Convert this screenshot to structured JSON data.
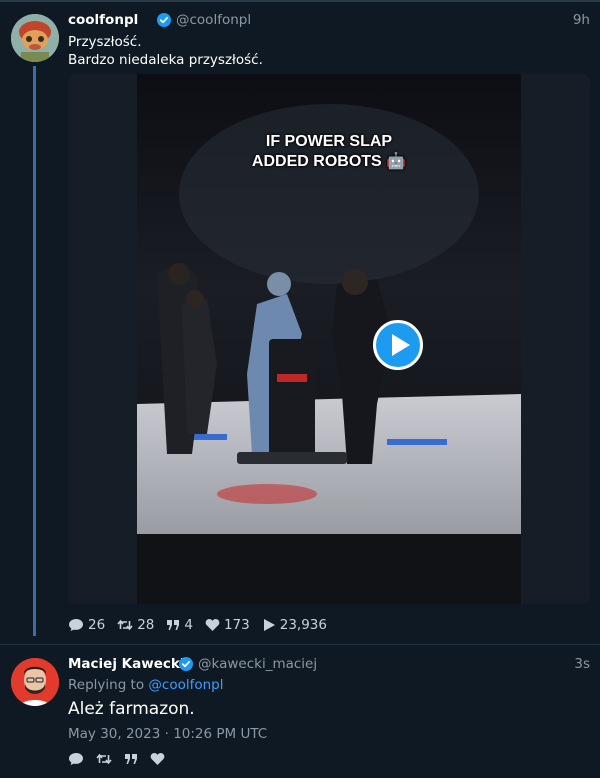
{
  "colors": {
    "background": "#0f1923",
    "thread_line": "#3a6ea5",
    "link": "#3e9bff",
    "verified": "#1d9bf0",
    "muted": "#8b98a5"
  },
  "tweet": {
    "display_name": "coolfonpl",
    "handle": "@coolfonpl",
    "time": "9h",
    "text_line_1": "Przyszłość.",
    "text_line_2": "Bardzo niedaleka przyszłość.",
    "media": {
      "caption_line_1": "IF POWER SLAP",
      "caption_line_2": "ADDED ROBOTS 🤖",
      "play_icon": "play-icon"
    },
    "stats": {
      "replies": "26",
      "retweets": "28",
      "quotes": "4",
      "likes": "173",
      "views": "23,936"
    }
  },
  "reply": {
    "display_name": "Maciej Kawecki",
    "handle": "@kawecki_maciej",
    "time": "3s",
    "replying_prefix": "Replying to",
    "replying_to": "@coolfonpl",
    "text": "Ależ farmazon.",
    "timestamp": "May 30, 2023 · 10:26 PM UTC"
  }
}
